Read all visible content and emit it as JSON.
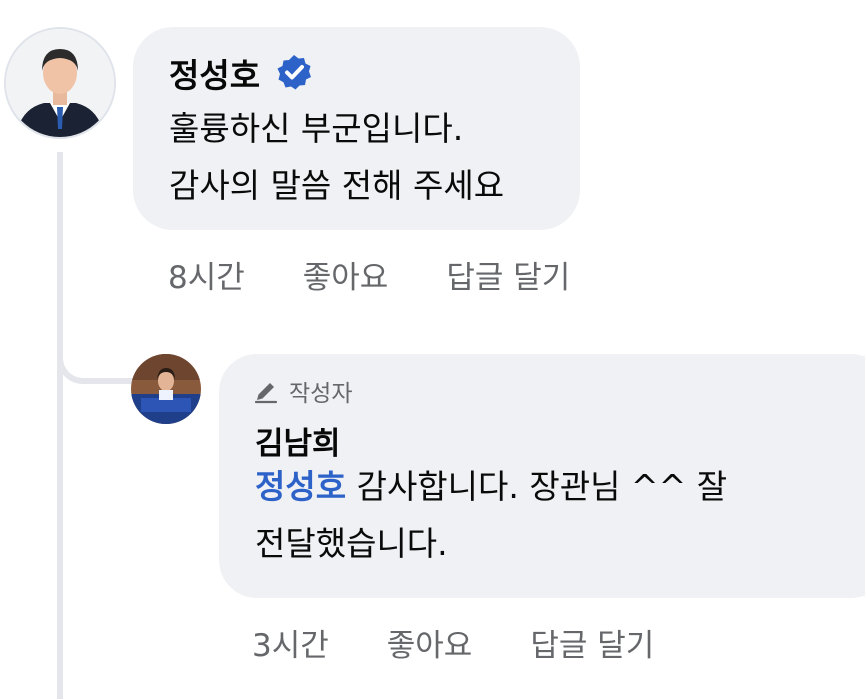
{
  "comment": {
    "author": "정성호",
    "verified": true,
    "text_lines": [
      "훌륭하신 부군입니다.",
      "감사의 말씀 전해 주세요"
    ],
    "actions": {
      "time": "8시간",
      "like": "좋아요",
      "reply": "답글 달기"
    }
  },
  "reply": {
    "badge_icon": "pencil-icon",
    "badge_label": "작성자",
    "author": "김남희",
    "mention": "정성호",
    "text_line1_rest": " 감사합니다. 장관님 ^^ 잘",
    "text_line2": "전달했습니다.",
    "actions": {
      "time": "3시간",
      "like": "좋아요",
      "reply": "답글 달기"
    }
  },
  "colors": {
    "bubble": "#eff1f4",
    "mention": "#2d62c8",
    "verified": "#2d62c8",
    "muted": "#65676b",
    "thread_line": "#e4e6eb"
  }
}
